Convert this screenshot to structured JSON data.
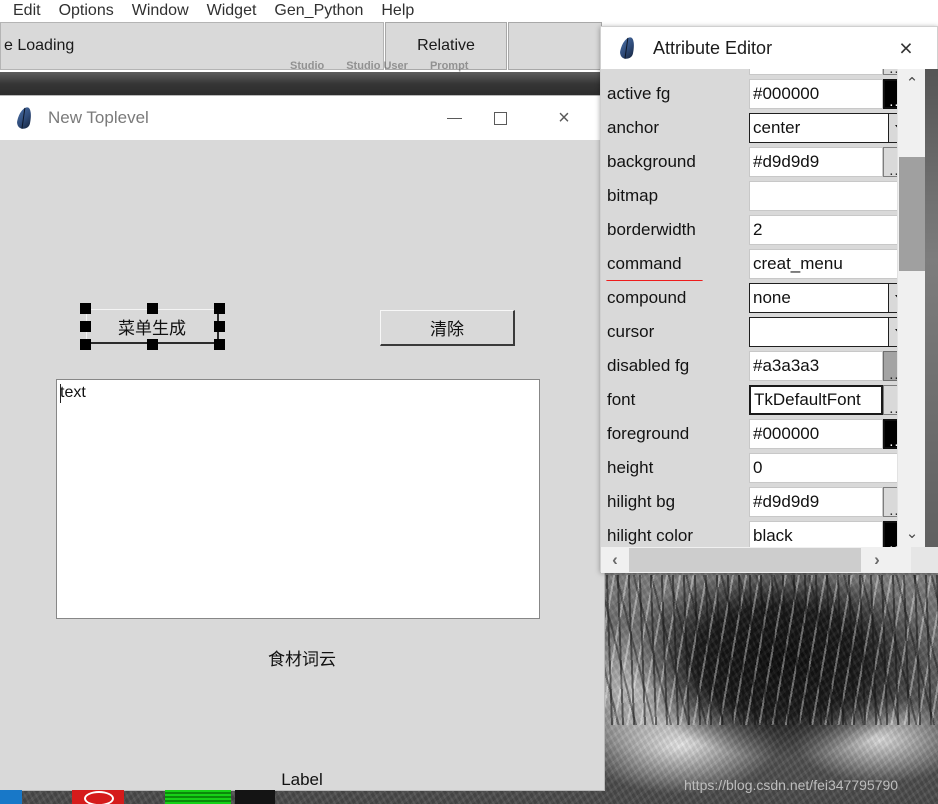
{
  "designer": {
    "menu": [
      {
        "label": "Edit"
      },
      {
        "label": "Options"
      },
      {
        "label": "Window"
      },
      {
        "label": "Widget"
      },
      {
        "label": "Gen_Python"
      },
      {
        "label": "Help"
      }
    ],
    "toolbar": {
      "status_field_value": "e Loading",
      "relative_button": "Relative",
      "blank_button": ""
    },
    "faded_labels": [
      "Studio",
      "Studio User",
      "Prompt"
    ]
  },
  "toplevel": {
    "title": "New Toplevel",
    "icon": "feather-icon",
    "controls": {
      "minimize": "minimize-icon",
      "maximize": "maximize-icon",
      "close": "×"
    },
    "selected_button": {
      "label": "菜单生成",
      "selected": true
    },
    "clear_button": {
      "label": "清除"
    },
    "text_widget": {
      "value": "text"
    },
    "wordcloud_label": "食材词云",
    "plain_label": "Label"
  },
  "attribute_editor": {
    "title": "Attribute Editor",
    "icon": "feather-icon",
    "close_label": "×",
    "highlighted_attribute": "command",
    "rows": [
      {
        "name": "",
        "value": "",
        "control": "color",
        "swatch": "#d9d9d9",
        "partial": true
      },
      {
        "name": "active fg",
        "value": "#000000",
        "control": "color",
        "swatch": "#000000"
      },
      {
        "name": "anchor",
        "value": "center",
        "control": "combo"
      },
      {
        "name": "background",
        "value": "#d9d9d9",
        "control": "color",
        "swatch": "#d9d9d9"
      },
      {
        "name": "bitmap",
        "value": "",
        "control": "text"
      },
      {
        "name": "borderwidth",
        "value": "2",
        "control": "text"
      },
      {
        "name": "command",
        "value": "creat_menu",
        "control": "text",
        "underlined": true
      },
      {
        "name": "compound",
        "value": "none",
        "control": "combo"
      },
      {
        "name": "cursor",
        "value": "",
        "control": "combo"
      },
      {
        "name": "disabled fg",
        "value": "#a3a3a3",
        "control": "color",
        "swatch": "#a3a3a3"
      },
      {
        "name": "font",
        "value": "TkDefaultFont",
        "control": "color",
        "swatch": "#d9d9d9",
        "focused": true
      },
      {
        "name": "foreground",
        "value": "#000000",
        "control": "color",
        "swatch": "#000000"
      },
      {
        "name": "height",
        "value": "0",
        "control": "text"
      },
      {
        "name": "hilight bg",
        "value": "#d9d9d9",
        "control": "color",
        "swatch": "#d9d9d9"
      },
      {
        "name": "hilight color",
        "value": "black",
        "control": "color",
        "swatch": "#000000"
      }
    ],
    "scroll": {
      "up_arrow": "⌃",
      "down_arrow": "⌄",
      "left_arrow": "‹",
      "right_arrow": "›"
    }
  },
  "watermark": "https://blog.csdn.net/fei347795790",
  "colors": {
    "window_bg": "#d9d9d9",
    "accent_red": "#ee1c1c",
    "titlebar": "#ffffff",
    "field_bg": "#ffffff"
  }
}
